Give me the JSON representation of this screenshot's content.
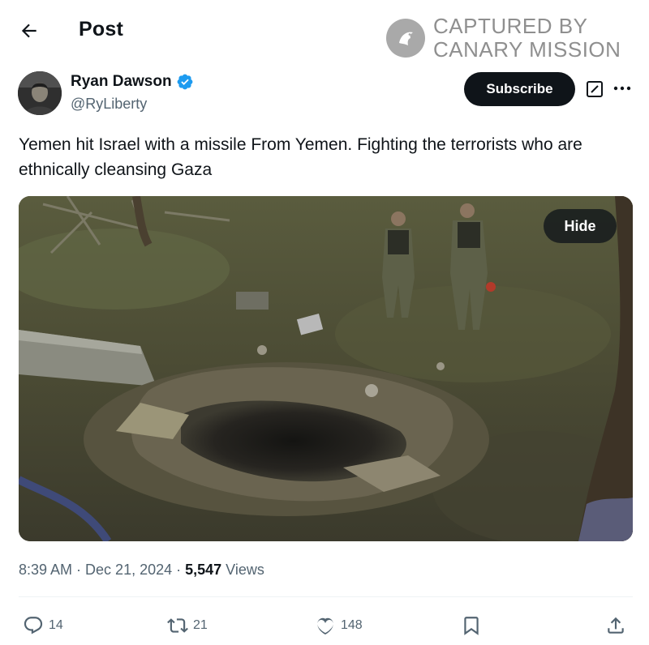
{
  "header": {
    "title": "Post",
    "back_icon": "arrow-left-icon"
  },
  "watermark": {
    "line1": "CAPTURED BY",
    "line2": "CANARY MISSION"
  },
  "author": {
    "name": "Ryan Dawson",
    "handle": "@RyLiberty",
    "verified": true,
    "verified_color": "#1d9bf0"
  },
  "buttons": {
    "subscribe": "Subscribe",
    "hide": "Hide"
  },
  "post": {
    "text": "Yemen hit Israel with a missile From Yemen. Fighting the terrorists who are ethnically cleansing Gaza"
  },
  "meta": {
    "time": "8:39 AM",
    "separator": " · ",
    "date": "Dec 21, 2024",
    "views_count": "5,547",
    "views_label": " Views"
  },
  "actions": {
    "replies": "14",
    "reposts": "21",
    "likes": "148"
  },
  "colors": {
    "text": "#0f1419",
    "secondary": "#536471",
    "accent": "#1d9bf0"
  }
}
